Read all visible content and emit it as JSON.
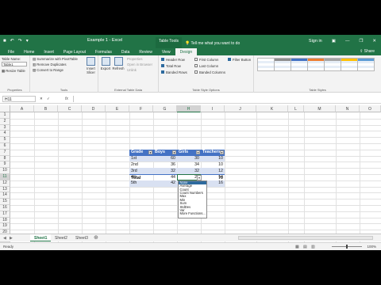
{
  "titlebar": {
    "document_title": "Example 1 - Excel",
    "context_tab": "Table Tools",
    "tell_me": "Tell me what you want to do",
    "sign_in": "Sign in",
    "share": "Share",
    "colors": {
      "brand": "#217346"
    }
  },
  "ribbon_tabs": [
    "File",
    "Home",
    "Insert",
    "Page Layout",
    "Formulas",
    "Data",
    "Review",
    "View",
    "Design"
  ],
  "ribbon": {
    "properties": {
      "table_name_label": "Table Name:",
      "table_name_value": "Table1",
      "resize": "Resize Table",
      "label": "Properties"
    },
    "tools": {
      "items": [
        "Summarize with PivotTable",
        "Remove Duplicates",
        "Convert to Range"
      ],
      "insert_slicer": "Insert Slicer",
      "label": "Tools"
    },
    "external": {
      "export": "Export",
      "refresh": "Refresh",
      "items": [
        "Properties",
        "Open in Browser",
        "Unlink"
      ],
      "label": "External Table Data"
    },
    "style_options": {
      "col1": [
        {
          "label": "Header Row",
          "checked": true
        },
        {
          "label": "Total Row",
          "checked": true
        },
        {
          "label": "Banded Rows",
          "checked": true
        }
      ],
      "col2": [
        {
          "label": "First Column",
          "checked": false
        },
        {
          "label": "Last Column",
          "checked": false
        },
        {
          "label": "Banded Columns",
          "checked": false
        }
      ],
      "col3": [
        {
          "label": "Filter Button",
          "checked": true
        }
      ],
      "label": "Table Style Options"
    },
    "styles": {
      "label": "Table Styles",
      "swatch_colors": [
        "#ffffff",
        "#8e8e8e",
        "#4472c4",
        "#ed7d31",
        "#a5a5a5",
        "#ffc000",
        "#5b9bd5"
      ]
    }
  },
  "formula_bar": {
    "name_box": "H11",
    "fx": "fx"
  },
  "columns": [
    "A",
    "B",
    "C",
    "D",
    "E",
    "F",
    "G",
    "H",
    "I",
    "J",
    "K",
    "L",
    "M",
    "N",
    "O"
  ],
  "rows": [
    "1",
    "2",
    "3",
    "4",
    "5",
    "6",
    "7",
    "8",
    "9",
    "10",
    "11",
    "12",
    "13",
    "14",
    "15",
    "16",
    "17",
    "18",
    "19",
    "20",
    "21",
    "22",
    "23",
    "24",
    "25"
  ],
  "table": {
    "headers": [
      "Grade",
      "Boys",
      "Girls",
      "Teachers"
    ],
    "rows": [
      [
        "1st",
        "60",
        "30",
        "10"
      ],
      [
        "2nd",
        "36",
        "34",
        "10"
      ],
      [
        "3rd",
        "32",
        "32",
        "12"
      ],
      [
        "4th",
        "44",
        "28",
        "14"
      ],
      [
        "5th",
        "42",
        "38",
        "16"
      ]
    ],
    "total_label": "Total",
    "total_value": "70",
    "colors": {
      "header": "#4472c4",
      "band": "#d9e1f2"
    }
  },
  "total_dropdown": {
    "options": [
      "None",
      "Average",
      "Count",
      "Count Numbers",
      "Max",
      "Min",
      "Sum",
      "StdDev",
      "Var",
      "More Functions..."
    ],
    "selected": "None"
  },
  "sheets": [
    "Sheet1",
    "Sheet2",
    "Sheet3"
  ],
  "status": {
    "ready": "Ready",
    "zoom": "100%"
  }
}
